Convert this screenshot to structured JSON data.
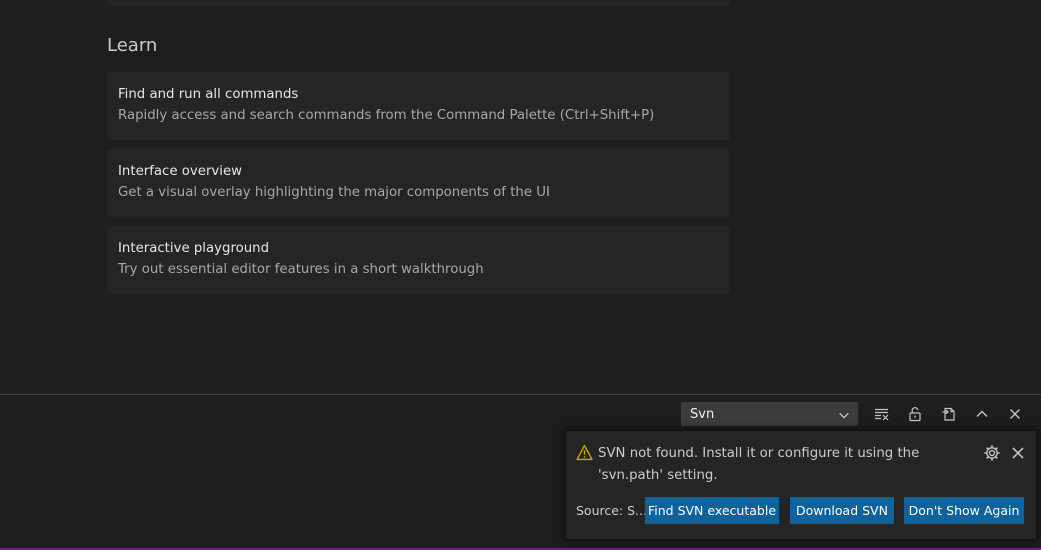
{
  "learn": {
    "heading": "Learn",
    "cards": [
      {
        "title": "Find and run all commands",
        "description": "Rapidly access and search commands from the Command Palette (Ctrl+Shift+P)"
      },
      {
        "title": "Interface overview",
        "description": "Get a visual overlay highlighting the major components of the UI"
      },
      {
        "title": "Interactive playground",
        "description": "Try out essential editor features in a short walkthrough"
      }
    ]
  },
  "panel": {
    "output_channel": "Svn",
    "actions": [
      "clear-output-icon",
      "lock-scroll-icon",
      "open-log-file-icon",
      "maximize-panel-icon",
      "close-panel-icon"
    ]
  },
  "notification": {
    "message": "SVN not found. Install it or configure it using the 'svn.path' setting.",
    "source_label": "Source: S...",
    "buttons": {
      "find": "Find SVN executable",
      "download": "Download SVN",
      "dont_show": "Don't Show Again"
    },
    "colors": {
      "warning": "#cca700",
      "button": "#0e639c"
    }
  },
  "colors": {
    "background": "#1e1e1e",
    "card": "#252526",
    "status_bar_accent": "#68217a"
  }
}
